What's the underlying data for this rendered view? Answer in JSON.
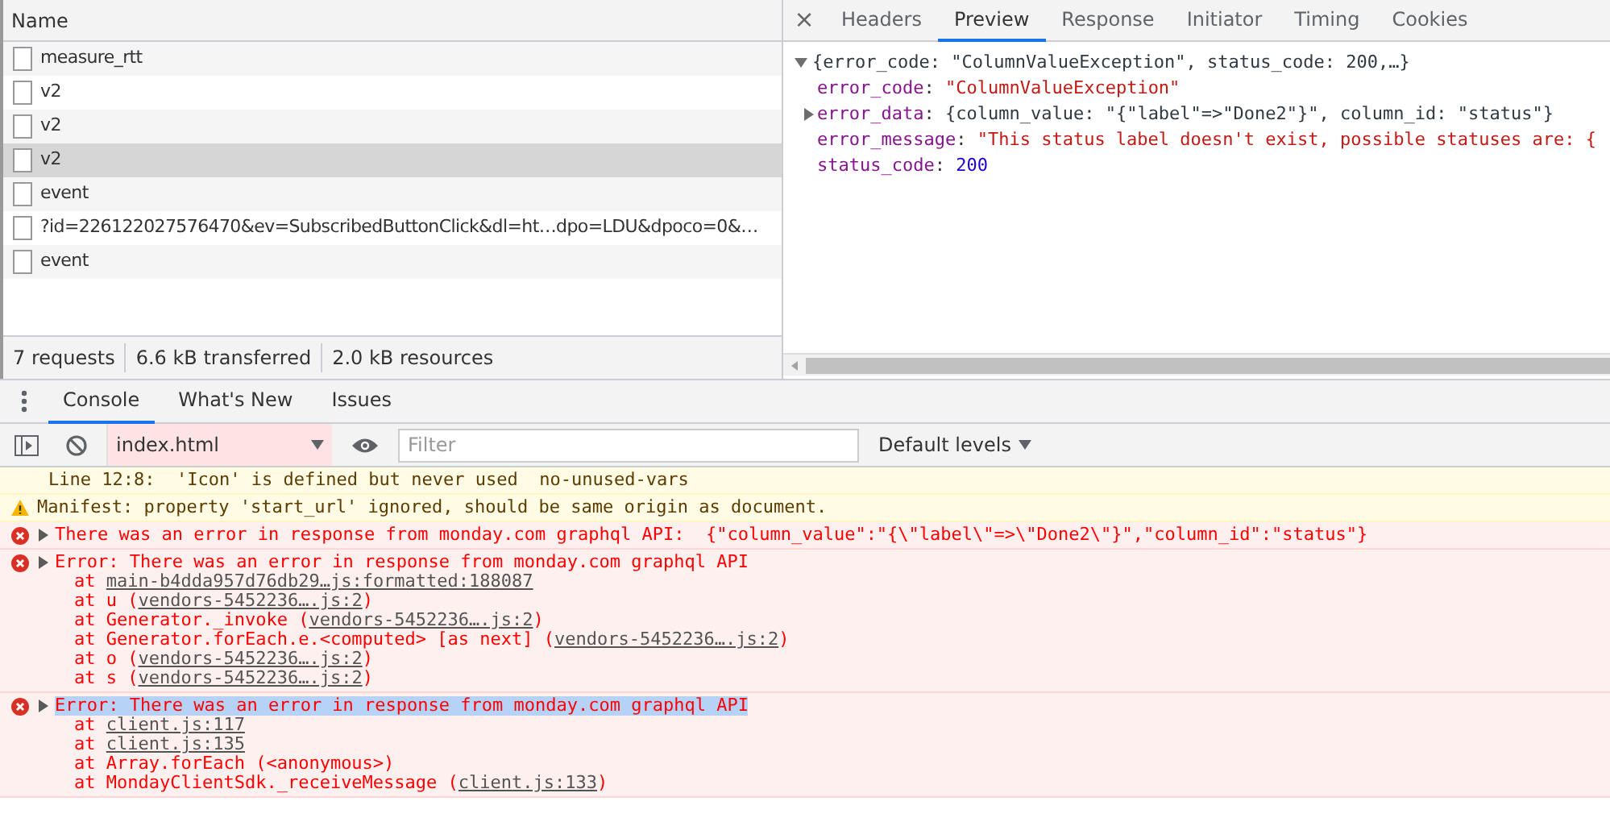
{
  "network": {
    "column_header": "Name",
    "rows": [
      {
        "name": "measure_rtt",
        "selected": false
      },
      {
        "name": "v2",
        "selected": false
      },
      {
        "name": "v2",
        "selected": false
      },
      {
        "name": "v2",
        "selected": true
      },
      {
        "name": "event",
        "selected": false
      },
      {
        "name": "?id=226122027576470&ev=SubscribedButtonClick&dl=ht…dpo=LDU&dpoco=0&…",
        "selected": false
      },
      {
        "name": "event",
        "selected": false
      }
    ],
    "status_bar": [
      "7 requests",
      "6.6 kB transferred",
      "2.0 kB resources"
    ]
  },
  "details": {
    "close": "×",
    "tabs": [
      {
        "label": "Headers",
        "selected": false
      },
      {
        "label": "Preview",
        "selected": true
      },
      {
        "label": "Response",
        "selected": false
      },
      {
        "label": "Initiator",
        "selected": false
      },
      {
        "label": "Timing",
        "selected": false
      },
      {
        "label": "Cookies",
        "selected": false
      }
    ],
    "preview": {
      "separator": ": ",
      "summary": "{error_code: \"ColumnValueException\", status_code: 200,…}",
      "expanded": true,
      "properties": [
        {
          "key": "error_code",
          "kind": "string",
          "value": "\"ColumnValueException\""
        },
        {
          "key": "error_data",
          "kind": "object",
          "expanded": false,
          "value": "{column_value: \"{\"label\"=>\"Done2\"}\", column_id: \"status\"}"
        },
        {
          "key": "error_message",
          "kind": "string",
          "value": "\"This status label doesn't exist, possible statuses are: {"
        },
        {
          "key": "status_code",
          "kind": "number",
          "value": "200"
        }
      ]
    }
  },
  "drawer": {
    "tabs": [
      {
        "label": "Console",
        "selected": true
      },
      {
        "label": "What's New",
        "selected": false
      },
      {
        "label": "Issues",
        "selected": false
      }
    ]
  },
  "console": {
    "context": "index.html",
    "filter": {
      "placeholder": "Filter"
    },
    "levels": "Default levels",
    "messages": [
      {
        "kind": "plain",
        "text": "Line 12:8:  'Icon' is defined but never used  no-unused-vars"
      },
      {
        "kind": "warning",
        "text": "Manifest: property 'start_url' ignored, should be same origin as document."
      },
      {
        "kind": "error",
        "expanded": false,
        "highlighted": false,
        "text": "There was an error in response from monday.com graphql API:  {\"column_value\":\"{\\\"label\\\"=>\\\"Done2\\\"}\",\"column_id\":\"status\"}"
      },
      {
        "kind": "error",
        "expanded": false,
        "highlighted": false,
        "text": "Error: There was an error in response from monday.com graphql API",
        "frames": [
          {
            "text": "at ",
            "link": "main-b4dda957d76db29…js:formatted:188087"
          },
          {
            "text": "at u (",
            "link": "vendors-5452236….js:2",
            "suffix": ")"
          },
          {
            "text": "at Generator._invoke (",
            "link": "vendors-5452236….js:2",
            "suffix": ")"
          },
          {
            "text": "at Generator.forEach.e.<computed> [as next] (",
            "link": "vendors-5452236….js:2",
            "suffix": ")"
          },
          {
            "text": "at o (",
            "link": "vendors-5452236….js:2",
            "suffix": ")"
          },
          {
            "text": "at s (",
            "link": "vendors-5452236….js:2",
            "suffix": ")"
          }
        ]
      },
      {
        "kind": "error",
        "expanded": false,
        "highlighted": true,
        "text": "Error: There was an error in response from monday.com graphql API",
        "frames": [
          {
            "text": "at ",
            "link": "client.js:117"
          },
          {
            "text": "at ",
            "link": "client.js:135"
          },
          {
            "text": "at Array.forEach (<anonymous>)"
          },
          {
            "text": "at MondayClientSdk._receiveMessage (",
            "link": "client.js:133",
            "suffix": ")"
          }
        ]
      }
    ]
  }
}
